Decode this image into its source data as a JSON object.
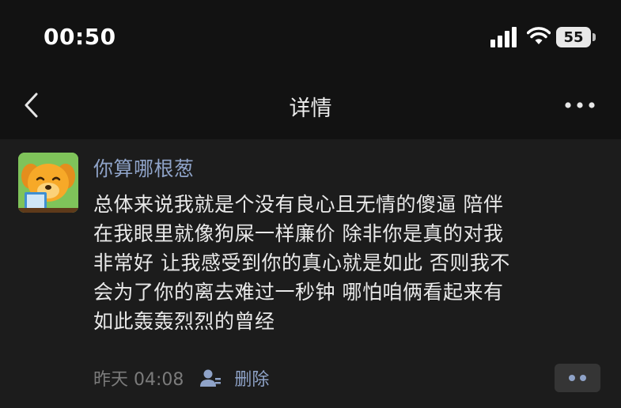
{
  "status_bar": {
    "time": "00:50",
    "battery": "55"
  },
  "nav": {
    "title": "详情",
    "back_icon": "chevron-left-icon",
    "more_icon": "more-horizontal-icon"
  },
  "post": {
    "username": "你算哪根葱",
    "text": "总体来说我就是个没有良心且无情的傻逼 陪伴\n在我眼里就像狗屎一样廉价 除非你是真的对我\n非常好  让我感受到你的真心就是如此 否则我不\n会为了你的离去难过一秒钟 哪怕咱俩看起来有\n如此轰轰烈烈的曾经",
    "time_ago": "昨天 04:08",
    "delete_label": "删除",
    "privacy_icon": "person-icon",
    "action_icon": "two-dots-icon"
  },
  "colors": {
    "background": "#121212",
    "card": "#1c1c1c",
    "link": "#8fa3c8",
    "muted": "#7b7b7b"
  }
}
